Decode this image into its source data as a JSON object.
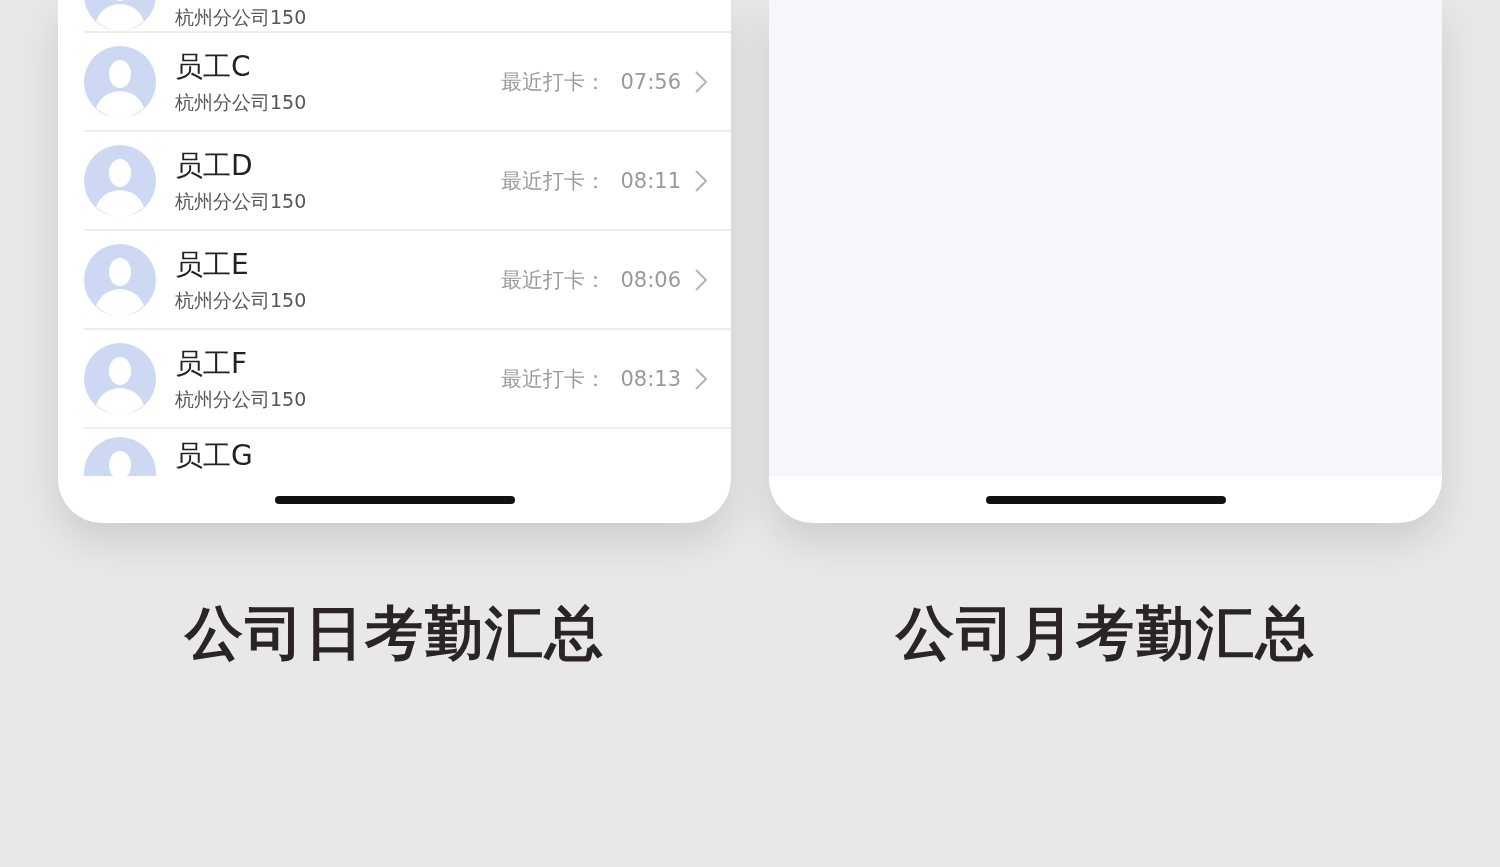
{
  "phones": [
    {
      "kind": "list",
      "rows": [
        {
          "company": "杭州分公司150"
        },
        {
          "name": "员工C",
          "company": "杭州分公司150",
          "label": "最近打卡：",
          "time": "07:56"
        },
        {
          "name": "员工D",
          "company": "杭州分公司150",
          "label": "最近打卡：",
          "time": "08:11"
        },
        {
          "name": "员工E",
          "company": "杭州分公司150",
          "label": "最近打卡：",
          "time": "08:06"
        },
        {
          "name": "员工F",
          "company": "杭州分公司150",
          "label": "最近打卡：",
          "time": "08:13"
        },
        {
          "name": "员工G"
        }
      ],
      "caption": "公司日考勤汇总"
    },
    {
      "kind": "blank",
      "caption": "公司月考勤汇总"
    }
  ]
}
